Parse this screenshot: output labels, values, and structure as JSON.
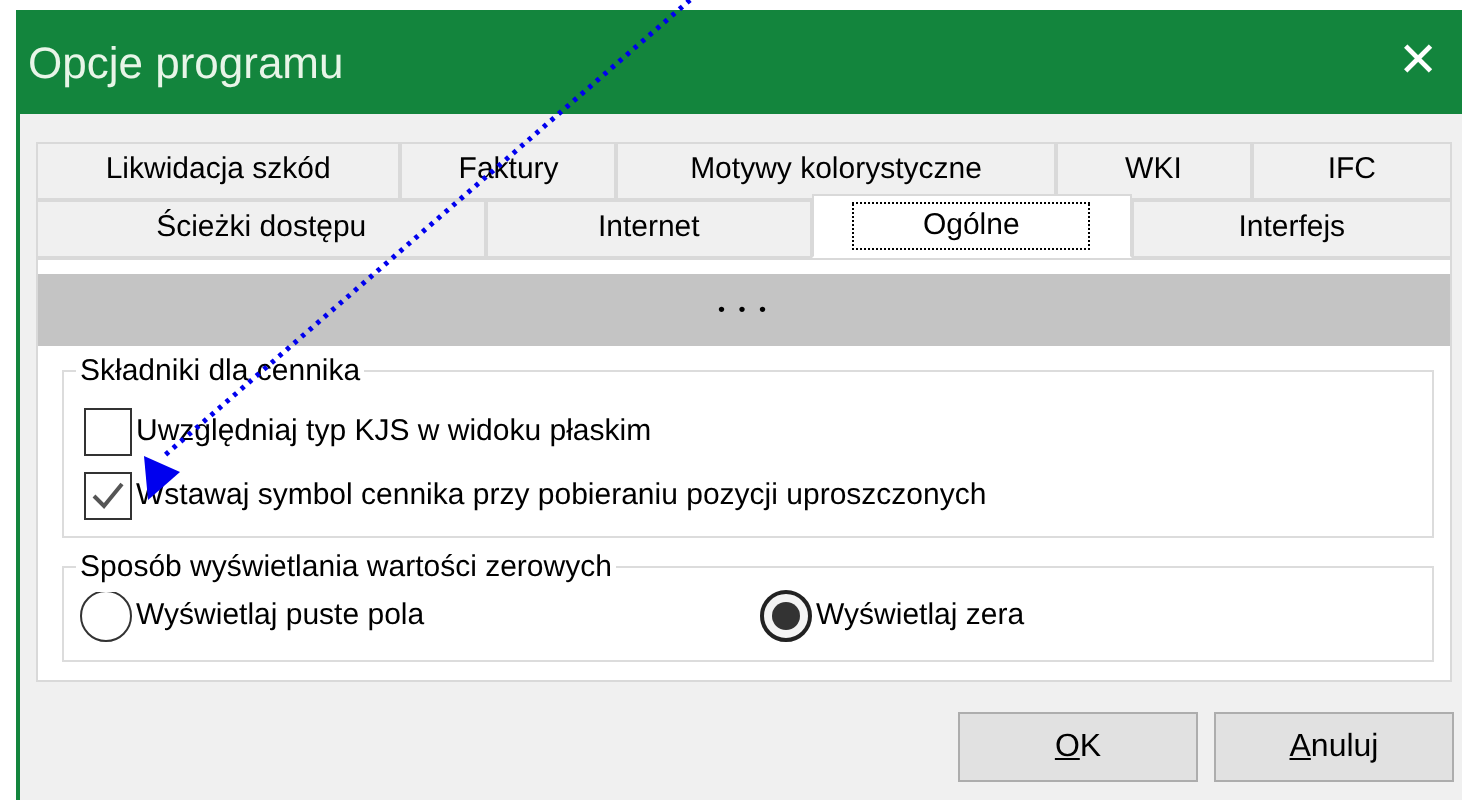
{
  "window": {
    "title": "Opcje programu",
    "close": "✕"
  },
  "tab_rows": [
    {
      "tabs": [
        {
          "label": "Likwidacja szkód",
          "selected": false
        },
        {
          "label": "Faktury",
          "selected": false
        },
        {
          "label": "Motywy kolorystyczne",
          "selected": false
        },
        {
          "label": "WKI",
          "selected": false
        },
        {
          "label": "IFC",
          "selected": false
        }
      ]
    },
    {
      "tabs": [
        {
          "label": "Ścieżki dostępu",
          "selected": false
        },
        {
          "label": "Internet",
          "selected": false
        },
        {
          "label": "Ogólne",
          "selected": true
        },
        {
          "label": "Interfejs",
          "selected": false
        }
      ]
    }
  ],
  "collapsed_band": {
    "label": "• • •"
  },
  "groups": [
    {
      "title": "Składniki dla cennika",
      "kind": "checkboxes",
      "items": [
        {
          "label": "Uwzględniaj typ KJS w widoku płaskim",
          "checked": false
        },
        {
          "label": "Wstawaj symbol cennika przy pobieraniu pozycji uproszczonych",
          "checked": true
        }
      ]
    },
    {
      "title": "Sposób wyświetlania wartości zerowych",
      "kind": "radios",
      "items": [
        {
          "label": "Wyświetlaj puste pola",
          "selected": false
        },
        {
          "label": "Wyświetlaj zera",
          "selected": true
        }
      ]
    }
  ],
  "buttons": [
    {
      "key": "O",
      "rest": "K"
    },
    {
      "key": "A",
      "rest": "nuluj"
    }
  ],
  "annotation": {
    "kind": "arrow"
  }
}
